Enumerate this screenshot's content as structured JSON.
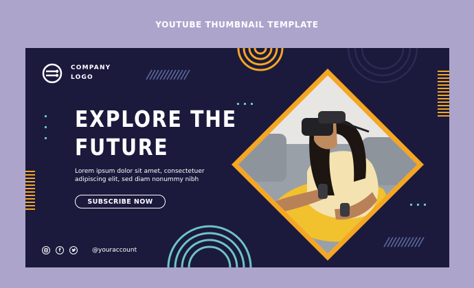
{
  "page": {
    "header": "YOUTUBE THUMBNAIL TEMPLATE"
  },
  "logo": {
    "line1": "COMPANY",
    "line2": "LOGO"
  },
  "headline": {
    "line1": "EXPLORE THE",
    "line2": "FUTURE"
  },
  "body": {
    "line1": "Lorem ipsum dolor sit amet, consectetuer",
    "line2": "adipiscing elit, sed diam nonummy nibh"
  },
  "cta": {
    "label": "SUBSCRIBE NOW"
  },
  "social": {
    "icons": [
      "instagram-icon",
      "facebook-icon",
      "twitter-icon"
    ],
    "account": "@youraccount"
  },
  "colors": {
    "background": "#ada4cc",
    "card": "#1b1a3d",
    "accent_orange": "#f5a623",
    "accent_teal": "#6fc4c4",
    "stripes": "#5e6a9e"
  }
}
